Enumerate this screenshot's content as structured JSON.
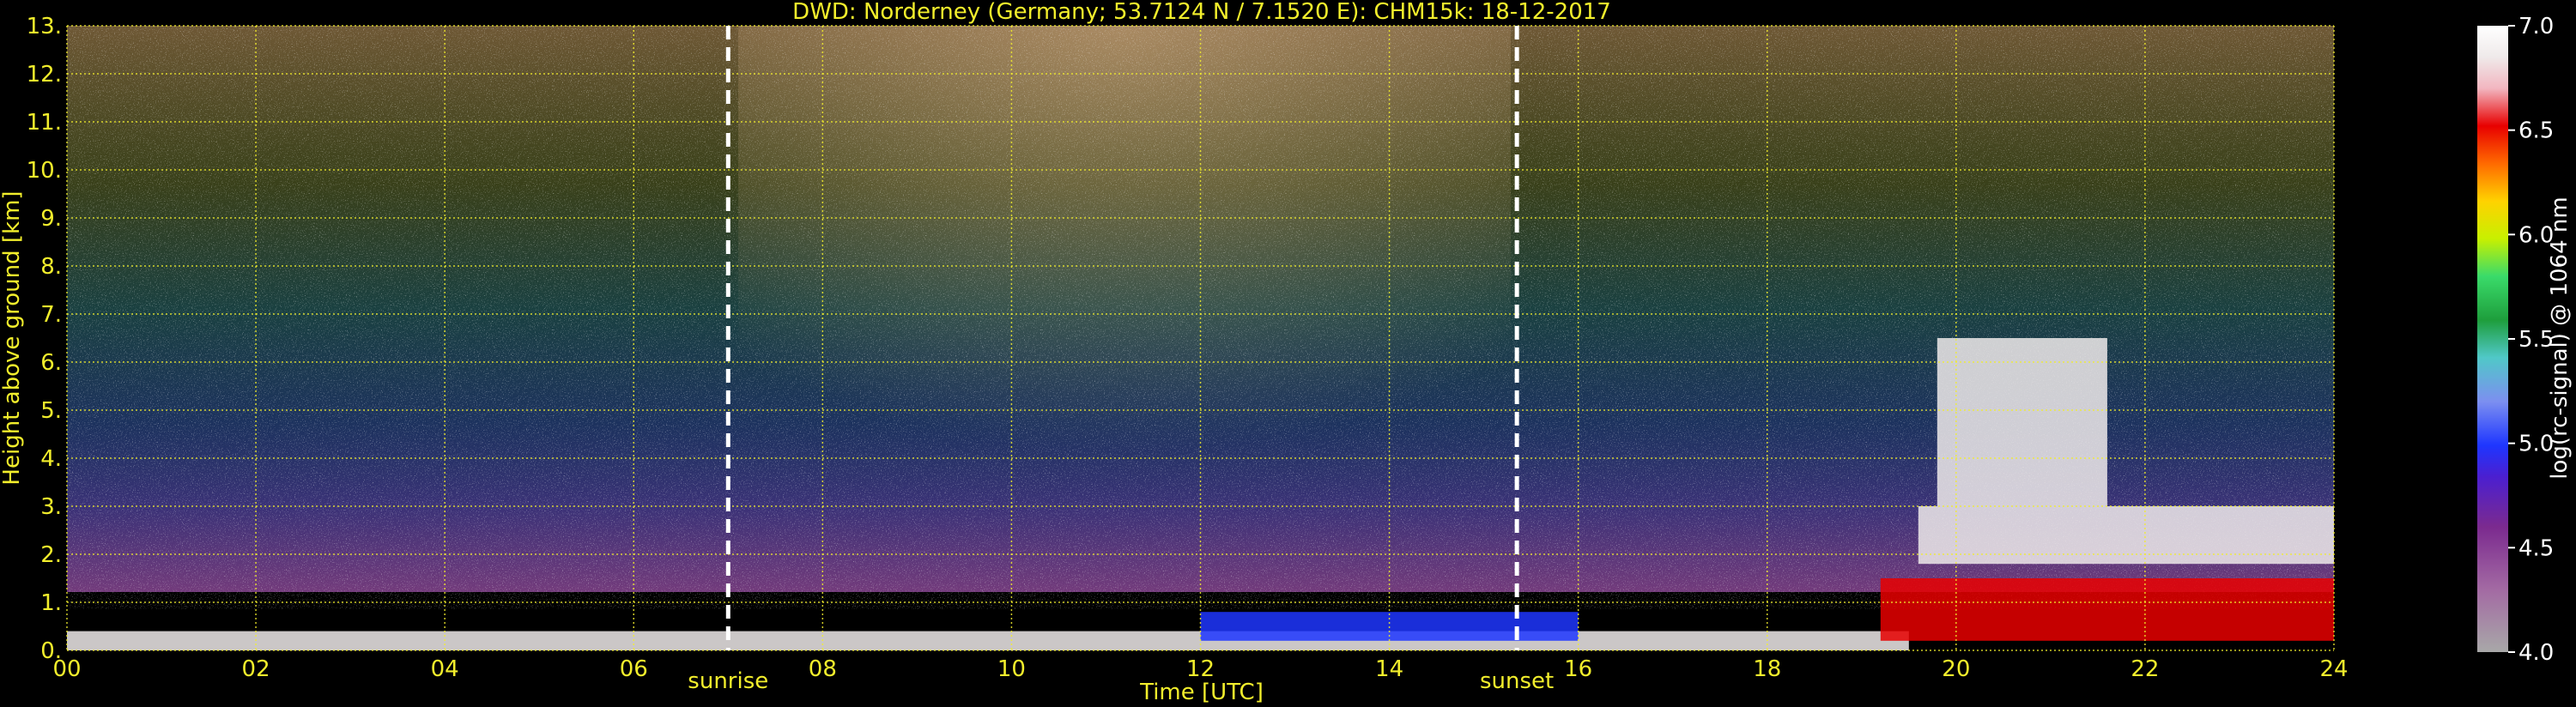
{
  "chart_data": {
    "type": "heatmap",
    "title": "DWD: Norderney (Germany; 53.7124 N / 7.1520 E):    CHM15k: 18-12-2017",
    "xlabel": "Time [UTC]",
    "ylabel": "Height above ground [km]",
    "xlim": [
      0,
      24
    ],
    "ylim": [
      0,
      13
    ],
    "x_ticks": [
      "00",
      "02",
      "04",
      "06",
      "08",
      "10",
      "12",
      "14",
      "16",
      "18",
      "20",
      "22",
      "24"
    ],
    "y_ticks": [
      "0.",
      "1.",
      "2.",
      "3.",
      "4.",
      "5.",
      "6.",
      "7.",
      "8.",
      "9.",
      "10.",
      "11.",
      "12.",
      "13."
    ],
    "grid": true,
    "grid_color": "#f2ee2c",
    "background": "#000000",
    "annotations": [
      {
        "label": "sunrise",
        "x": 7.0
      },
      {
        "label": "sunset",
        "x": 15.35
      }
    ],
    "colorbar": {
      "label": "log(rc-signal) @ 1064 nm",
      "range": [
        4.0,
        7.0
      ],
      "ticks": [
        "4.0",
        "4.5",
        "5.0",
        "5.5",
        "6.0",
        "6.5",
        "7.0"
      ]
    },
    "features": [
      {
        "x_range": [
          0,
          19.5
        ],
        "height_km": [
          0,
          0.4
        ],
        "level": 6.6
      },
      {
        "x_range": [
          12,
          16
        ],
        "height_km": [
          0.2,
          0.8
        ],
        "level": 5.2
      },
      {
        "x_range": [
          19.2,
          24
        ],
        "height_km": [
          0.2,
          1.5
        ],
        "level": 6.2
      },
      {
        "x_range": [
          19.6,
          24
        ],
        "height_km": [
          1.8,
          3.0
        ],
        "level": 6.6
      },
      {
        "x_range": [
          19.8,
          21.6
        ],
        "height_km": [
          3.0,
          6.5
        ],
        "level": 6.5
      }
    ]
  }
}
